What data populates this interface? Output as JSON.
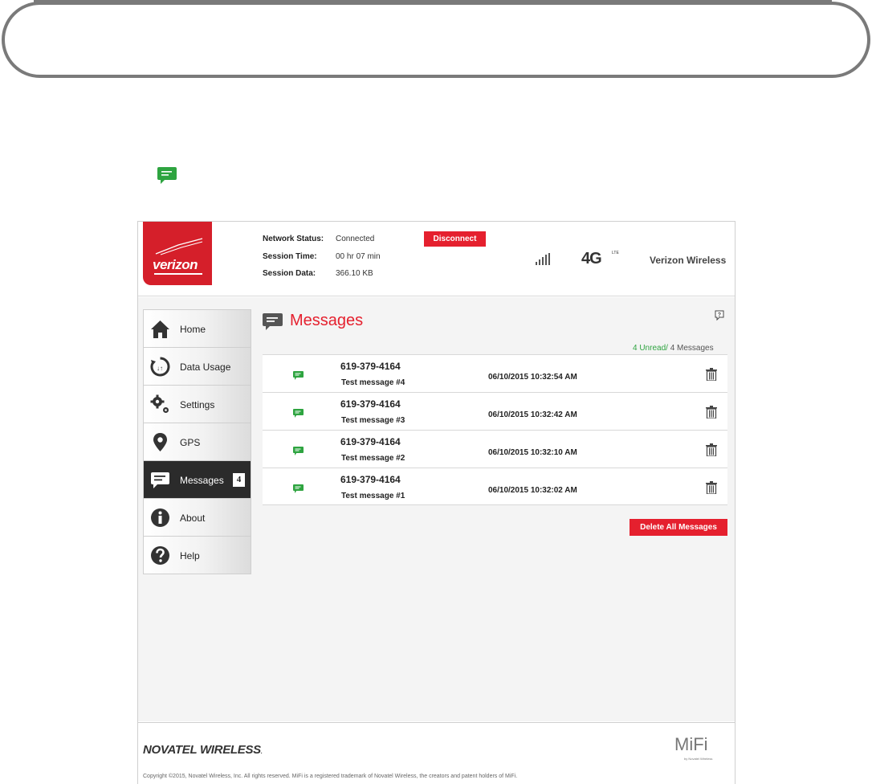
{
  "header": {
    "logo": "verizon",
    "network_status_label": "Network Status:",
    "network_status_value": "Connected",
    "session_time_label": "Session Time:",
    "session_time_value": "00 hr 07 min",
    "session_data_label": "Session Data:",
    "session_data_value": "366.10 KB",
    "disconnect_label": "Disconnect",
    "network_type": "4G",
    "network_type_sub": "LTE",
    "carrier": "Verizon Wireless"
  },
  "sidebar": {
    "items": [
      {
        "label": "Home",
        "icon": "home-icon"
      },
      {
        "label": "Data Usage",
        "icon": "data-usage-icon"
      },
      {
        "label": "Settings",
        "icon": "gear-icon"
      },
      {
        "label": "GPS",
        "icon": "location-pin-icon"
      },
      {
        "label": "Messages",
        "icon": "message-icon",
        "badge": "4",
        "active": true
      },
      {
        "label": "About",
        "icon": "info-icon"
      },
      {
        "label": "Help",
        "icon": "question-icon"
      }
    ]
  },
  "main": {
    "title": "Messages",
    "count_unread": "4 Unread/",
    "count_total": " 4 Messages",
    "messages": [
      {
        "phone": "619-379-4164",
        "text": "Test message #4",
        "date": "06/10/2015 10:32:54 AM"
      },
      {
        "phone": "619-379-4164",
        "text": "Test message #3",
        "date": "06/10/2015 10:32:42 AM"
      },
      {
        "phone": "619-379-4164",
        "text": "Test message #2",
        "date": "06/10/2015 10:32:10 AM"
      },
      {
        "phone": "619-379-4164",
        "text": "Test message #1",
        "date": "06/10/2015 10:32:02 AM"
      }
    ],
    "delete_all_label": "Delete All Messages"
  },
  "footer": {
    "brand": "NOVATEL WIRELESS",
    "brand_mark": ".",
    "mifi": "MiFi",
    "mifi_sub": "by Novatel Wireless",
    "copyright": "Copyright ©2015, Novatel Wireless, Inc. All rights reserved. MiFi is a registered trademark of Novatel Wireless, the creators and patent holders of MiFi."
  },
  "colors": {
    "accent_red": "#e5202e",
    "verizon_red": "#d51f2a",
    "unread_green": "#2ea440",
    "active_nav": "#2b2b2b"
  }
}
